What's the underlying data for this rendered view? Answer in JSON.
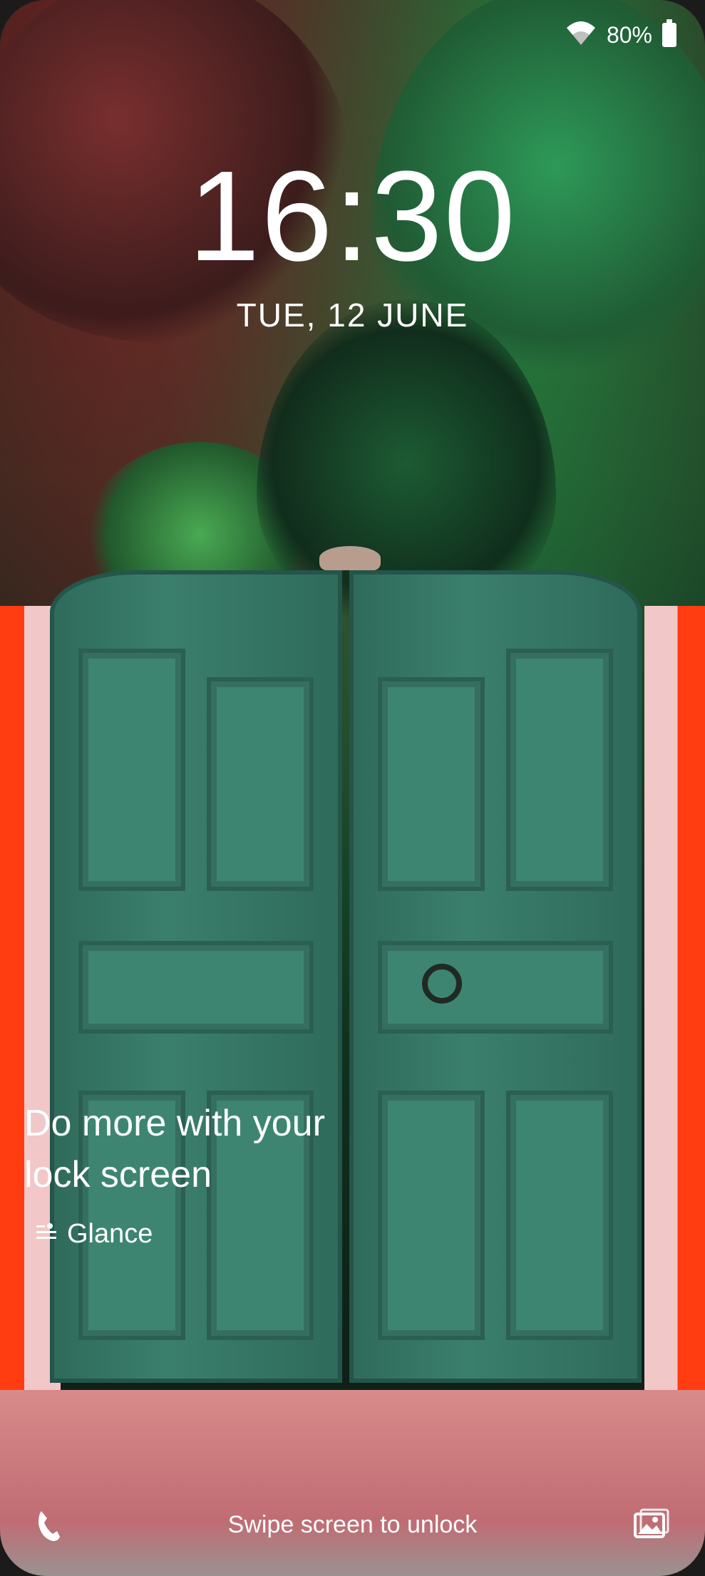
{
  "status_bar": {
    "battery_percent": "80%",
    "wifi_icon": "wifi-icon",
    "battery_icon": "battery-icon"
  },
  "lock": {
    "time": "16:30",
    "date": "TUE, 12 JUNE"
  },
  "promo": {
    "line1": "Do more with your",
    "line2": "lock screen"
  },
  "glance": {
    "label": "Glance",
    "icon": "glance-icon"
  },
  "bottom": {
    "unlock_hint": "Swipe screen to unlock",
    "left_icon": "phone-icon",
    "right_icon": "gallery-icon"
  },
  "colors": {
    "text": "#FFFFFF",
    "gate": "#3A7F6C",
    "pillar": "#FF3D10"
  }
}
